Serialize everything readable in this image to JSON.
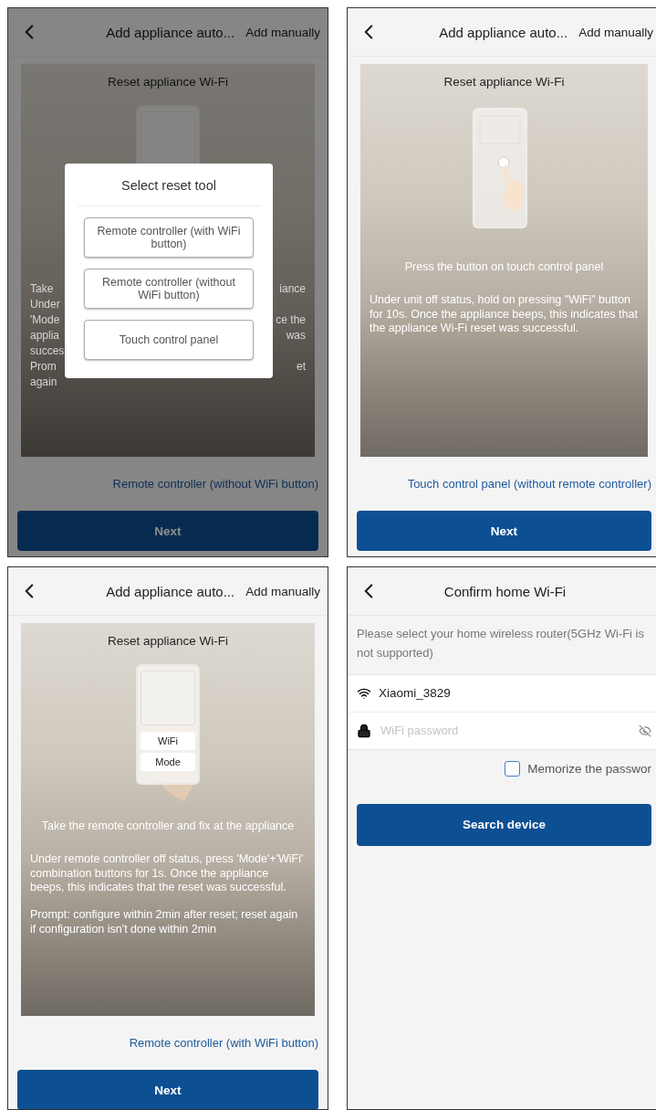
{
  "screens": [
    {
      "kind": "reset",
      "header": {
        "title": "Add appliance auto...",
        "action": "Add manually"
      },
      "card": {
        "title": "Reset appliance Wi-Fi",
        "illustration": {
          "kind": "remote"
        },
        "covered_lines": [
          {
            "left": "Take",
            "right": "iance"
          },
          {
            "left": "Under"
          },
          {
            "left": "'Mode",
            "right": "ce the"
          },
          {
            "left": "applia",
            "right": "was"
          },
          {
            "left": "succes"
          },
          {
            "left": "Prom",
            "right": "et"
          },
          {
            "left": "again"
          }
        ]
      },
      "link": "Remote controller (without WiFi button)",
      "button": "Next",
      "dialog": {
        "title": "Select reset tool",
        "options": [
          "Remote controller (with WiFi button)",
          "Remote controller (without WiFi button)",
          "Touch control panel"
        ]
      }
    },
    {
      "kind": "reset",
      "header": {
        "title": "Add appliance auto...",
        "action": "Add manually"
      },
      "card": {
        "title": "Reset appliance Wi-Fi",
        "illustration": {
          "kind": "touch"
        },
        "caption": "Press the button on touch control panel",
        "paragraphs": [
          "Under unit off status, hold on pressing \"WiFi\" button for 10s. Once the appliance beeps, this indicates that the appliance Wi-Fi reset was successful."
        ]
      },
      "link": "Touch control panel (without remote controller)",
      "button": "Next"
    },
    {
      "kind": "reset",
      "header": {
        "title": "Add appliance auto...",
        "action": "Add manually"
      },
      "card": {
        "title": "Reset appliance Wi-Fi",
        "illustration": {
          "kind": "remote",
          "keys": [
            "WiFi",
            "Mode"
          ]
        },
        "caption": "Take the remote controller and fix at the appliance",
        "paragraphs": [
          "Under remote controller off status, press 'Mode'+'WiFi' combination buttons for 1s. Once the appliance beeps, this indicates that the reset was successful.",
          "Prompt: configure within 2min after reset; reset again if configuration isn't done within 2min"
        ]
      },
      "link": "Remote controller (with WiFi button)",
      "button": "Next"
    },
    {
      "kind": "wifi",
      "header": {
        "title": "Confirm home Wi-Fi"
      },
      "hint": "Please select your home wireless router(5GHz Wi-Fi is not supported)",
      "network": "Xiaomi_3829",
      "password": {
        "placeholder": "WiFi password"
      },
      "memorize": {
        "label": "Memorize the passwor",
        "checked": false
      },
      "button": "Search device"
    }
  ]
}
